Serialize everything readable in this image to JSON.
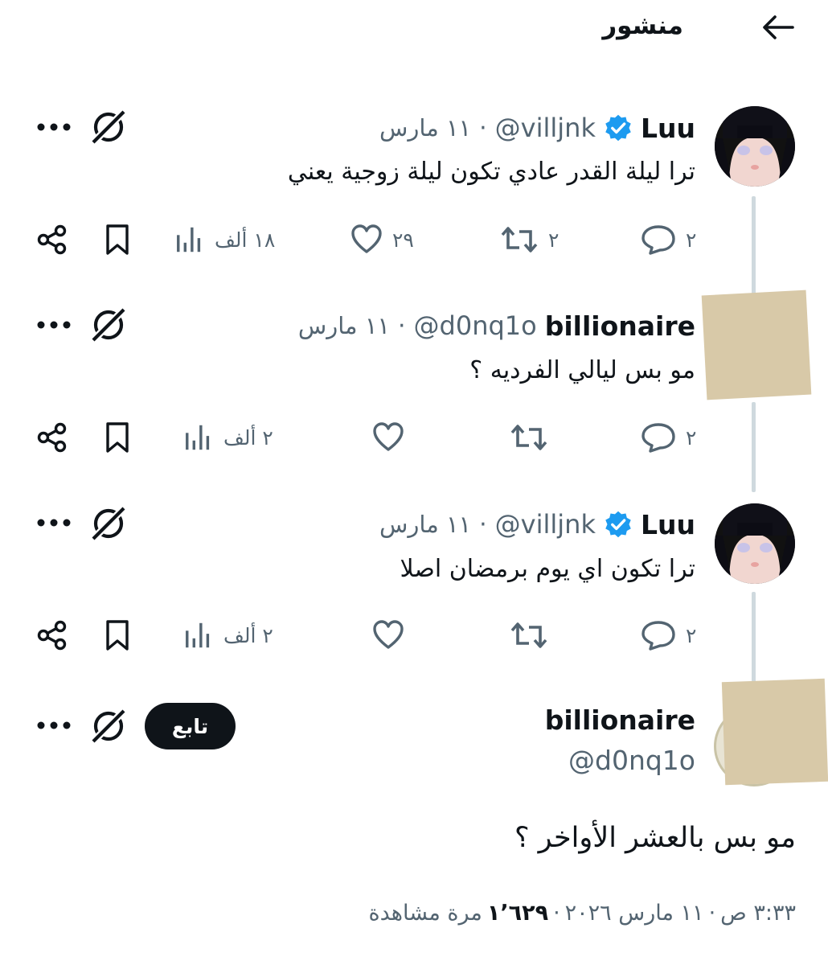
{
  "header": {
    "title": "منشور",
    "back_icon": "arrow-left-icon"
  },
  "tweets": [
    {
      "name": "Luu",
      "verified": true,
      "handle": "@villjnk",
      "separator": "·",
      "date": "١١ مارس",
      "text": "ترا ليلة القدر عادي تكون ليلة زوجية يعني",
      "replies": "٢",
      "retweets": "٢",
      "likes": "٢٩",
      "views": "١٨ ألف"
    },
    {
      "name": "billionaire",
      "verified": false,
      "handle": "@d0nq1o",
      "separator": "·",
      "date": "١١ مارس",
      "text": "مو بس ليالي الفرديه ؟",
      "replies": "٢",
      "retweets": "",
      "likes": "",
      "views": "٢ ألف"
    },
    {
      "name": "Luu",
      "verified": true,
      "handle": "@villjnk",
      "separator": "·",
      "date": "١١ مارس",
      "text": "ترا تكون اي يوم برمضان اصلا",
      "replies": "٢",
      "retweets": "",
      "likes": "",
      "views": "٢ ألف"
    }
  ],
  "main_tweet": {
    "name": "billionaire",
    "handle": "@d0nq1o",
    "follow_label": "تابع",
    "text": "مو بس بالعشر الأواخر ؟",
    "time": "٣:٣٣ ص",
    "separator": "·",
    "date": "١١ مارس ٢٠٢٦",
    "views_count": "١٬٦٢٩",
    "views_label": "مرة مشاهدة"
  },
  "colors": {
    "verified": "#1d9bf0",
    "muted": "#536471",
    "text": "#0f1419",
    "thread_line": "#cfd9de",
    "follow_bg": "#0f1419"
  },
  "icons": [
    "more-icon",
    "grok-icon",
    "share-icon",
    "bookmark-icon",
    "views-icon",
    "like-icon",
    "retweet-icon",
    "reply-icon",
    "verified-badge-icon"
  ]
}
